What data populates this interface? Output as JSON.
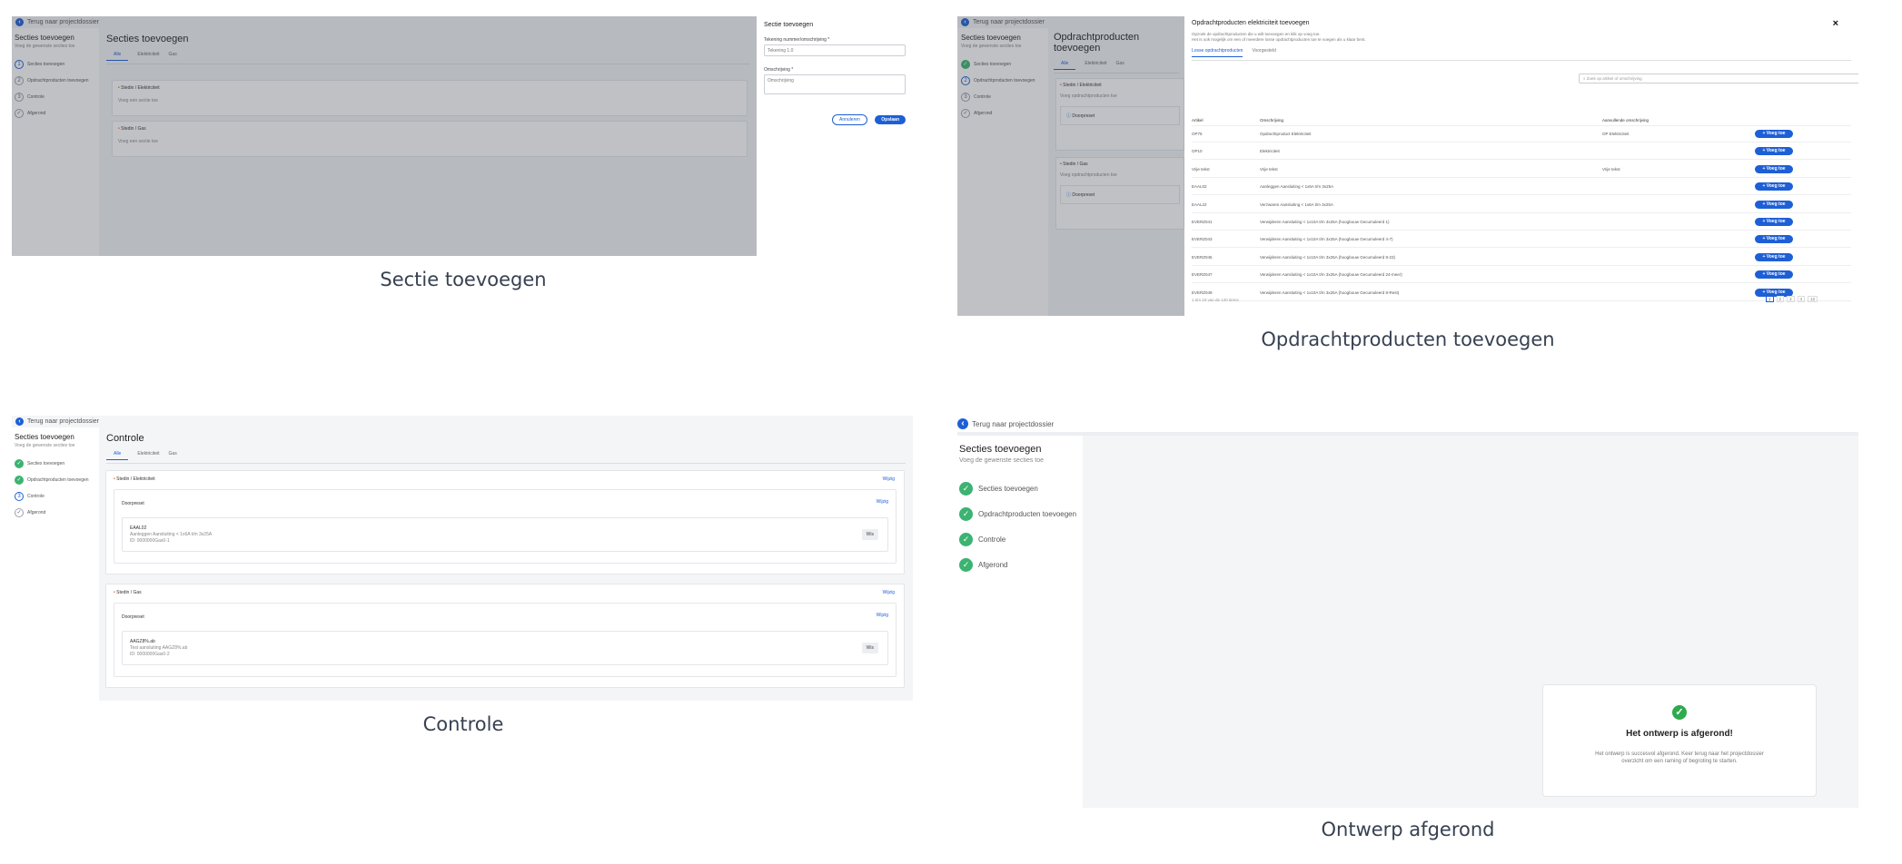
{
  "captions": {
    "q1": "Sectie toevoegen",
    "q2": "Opdrachtproducten toevoegen",
    "q3": "Controle",
    "q4": "Ontwerp afgerond"
  },
  "common": {
    "back": "Terug naar projectdossier",
    "sb_title": "Secties toevoegen",
    "sb_sub": "Voeg de gewenste secties toe",
    "steps": [
      "Secties toevoegen",
      "Opdrachtproducten toevoegen",
      "Controle",
      "Afgerond"
    ],
    "tabs": [
      "Alle",
      "Elektriciteit",
      "Gas"
    ],
    "sec_elec_prefix": "Stedin",
    "sec_elec": "Elektriciteit",
    "sec_gas_prefix": "Stedin",
    "sec_gas": "Gas",
    "add_product_hint": "Voeg opdrachtproducten toe",
    "fasing": "Doorpreset",
    "edit": "Wijzig",
    "remove": "Wis"
  },
  "q1": {
    "main_title": "Secties toevoegen",
    "add_hint": "Voeg een sectie toe",
    "panel_title": "Sectie toevoegen",
    "field1_label": "Tekening nummer/omschrijving *",
    "field1_value": "Tekening 1.0",
    "field2_label": "Omschrijving *",
    "field2_value": "Omschrijving",
    "cancel": "Annuleren",
    "save": "Opslaan"
  },
  "q2": {
    "main_title": "Opdrachtproducten toevoegen",
    "modal_title": "Opdrachtproducten elektriciteit toevoegen",
    "modal_sub1": "Opzoek de opdrachtproducten die u wilt toevoegen en klik op voeg toe.",
    "modal_sub2": "Het is ook mogelijk om een of meerdere losse opdrachtproducten toe te voegen als u klaar bent.",
    "close": "×",
    "tabs": [
      "Losse opdrachtproducten",
      "Voorgesteld"
    ],
    "search_placeholder": "Zoek op artikel of omschrijving",
    "columns": [
      "Artikel",
      "Omschrijving",
      "Aanvullende omschrijving",
      ""
    ],
    "rows": [
      [
        "OP75",
        "Opdrachtproduct Elektriciteit",
        "OP Elektriciteit"
      ],
      [
        "OP10",
        "Elektriciteit",
        ""
      ],
      [
        "Vrije tekst",
        "Vrije tekst",
        "Vrije tekst"
      ],
      [
        "EAAL02",
        "Aanleggen Aansluiting < 1x6A t/m 3x25A",
        ""
      ],
      [
        "EAAL22",
        "Verzwaren Aansluiting < 1x6A t/m 3x25A",
        ""
      ],
      [
        "EVERZ041",
        "Verwijderen Aansluiting < 1x10A t/m 3x25A (hoogbouw Gecumuleerd 1)",
        ""
      ],
      [
        "EVERZ043",
        "Verwijderen Aansluiting < 1x10A t/m 3x25A (hoogbouw Gecumuleerd 4-7)",
        ""
      ],
      [
        "EVERZ045",
        "Verwijderen Aansluiting < 1x10A t/m 3x25A (hoogbouw Gecumuleerd 8-23)",
        ""
      ],
      [
        "EVERZ047",
        "Verwijderen Aansluiting < 1x10A t/m 3x25A (hoogbouw Gecumuleerd 24-meer)",
        ""
      ],
      [
        "EVERZ049",
        "Verwijderen Aansluiting < 1x10A t/m 3x25A (hoogbouw Gecumuleerd 8-Rest)",
        ""
      ]
    ],
    "add": "Voeg toe",
    "footer": "1 t/m 10 van de 120 items",
    "pages": [
      "1",
      "2",
      "3",
      "4",
      "12"
    ]
  },
  "q3": {
    "main_title": "Controle",
    "item1_code": "EAAL02",
    "item1_desc": "Aanleggen Aansluiting < 1x6A t/m 3x25A",
    "item1_id": "ID: 0000000Gas0-1",
    "item2_code": "AAGZ8%.ab",
    "item2_desc": "Test aansluiting AAGZ8%.ab",
    "item2_id": "ID: 0000000Gas0-2"
  },
  "q4": {
    "done_title": "Het ontwerp is afgerond!",
    "done_text1": "Het ontwerp is succesvol afgerond. Keer terug naar het projectdossier",
    "done_text2": "overzicht om een raming of begroting te starten."
  }
}
